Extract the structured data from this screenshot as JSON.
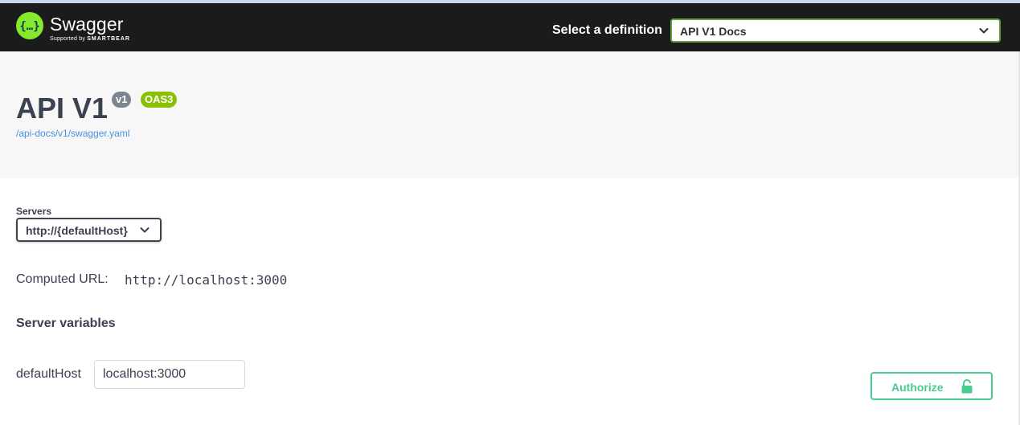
{
  "header": {
    "brand_name": "Swagger",
    "brand_sub_prefix": "Supported by",
    "brand_sub_company": "SMARTBEAR",
    "definition_label": "Select a definition",
    "definition_selected": "API V1 Docs",
    "logo_icon": "swagger-braces-icon"
  },
  "info": {
    "title": "API V1",
    "version_badge": "v1",
    "spec_badge": "OAS3",
    "spec_link": "/api-docs/v1/swagger.yaml"
  },
  "servers": {
    "label": "Servers",
    "selected": "http://{defaultHost}",
    "computed_url_label": "Computed URL:",
    "computed_url_value": "http://localhost:3000",
    "variables_heading": "Server variables",
    "variables": [
      {
        "name": "defaultHost",
        "value": "localhost:3000"
      }
    ]
  },
  "authorize": {
    "label": "Authorize",
    "icon": "unlocked-padlock-icon"
  },
  "colors": {
    "topbar_bg": "#1b1b1b",
    "brand_green": "#85ea2d",
    "select_border": "#62a03f",
    "badge_version": "#7d8492",
    "badge_spec": "#89bf04",
    "link": "#4990e2",
    "authorize": "#49cc90",
    "info_bg": "#f7f7f7"
  }
}
